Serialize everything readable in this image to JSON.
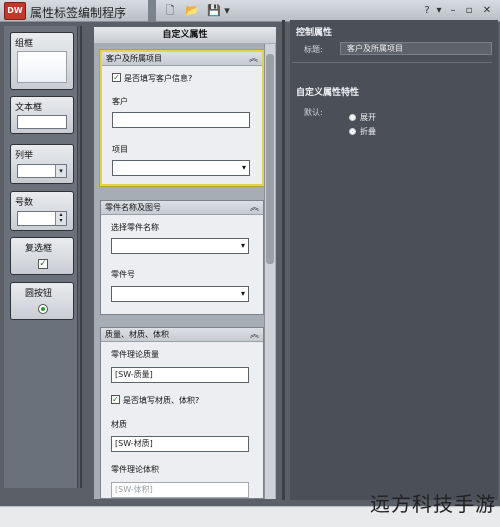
{
  "app": {
    "logo_text": "DW",
    "title": "属性标签编制程序"
  },
  "toolbar": [
    {
      "name": "new-file-icon",
      "glyph": "🗋"
    },
    {
      "name": "open-folder-icon",
      "glyph": "📂"
    },
    {
      "name": "save-icon",
      "glyph": "💾"
    },
    {
      "name": "dropdown-arrow-icon",
      "glyph": "▾"
    }
  ],
  "window_controls": {
    "help": "?",
    "help_arrow": "▾",
    "minimize": "–",
    "restore": "▫",
    "close": "✕"
  },
  "toolbox": {
    "group_box": "组框",
    "text_box": "文本框",
    "list": "列举",
    "number": "号数",
    "checkbox": "复选框",
    "radio_button": "圆按钮"
  },
  "form": {
    "header": "自定义属性",
    "group1": {
      "title": "客户及所属项目",
      "checkbox_label": "是否填写客户信息?",
      "customer_label": "客户",
      "customer_value": "",
      "project_label": "项目",
      "project_value": ""
    },
    "group2": {
      "title": "零件名称及图号",
      "part_name_label": "选择零件名称",
      "part_name_value": "",
      "part_no_label": "零件号",
      "part_no_value": ""
    },
    "group3": {
      "title": "质量、材质、体积",
      "mass_label": "零件理论质量",
      "mass_value": "[SW-质量]",
      "checkbox_label": "是否填写材质、体积?",
      "material_label": "材质",
      "material_value": "[SW-材质]",
      "volume_label": "零件理论体积",
      "volume_value": "[SW-体积]"
    }
  },
  "props": {
    "control_props_title": "控制属性",
    "title_label": "标题:",
    "title_value": "客户及所属项目",
    "custom_props_title": "自定义属性特性",
    "default_label": "默认:",
    "options": [
      {
        "label": "展开",
        "selected": false
      },
      {
        "label": "折叠",
        "selected": true
      }
    ]
  },
  "watermark": "远方科技手游"
}
